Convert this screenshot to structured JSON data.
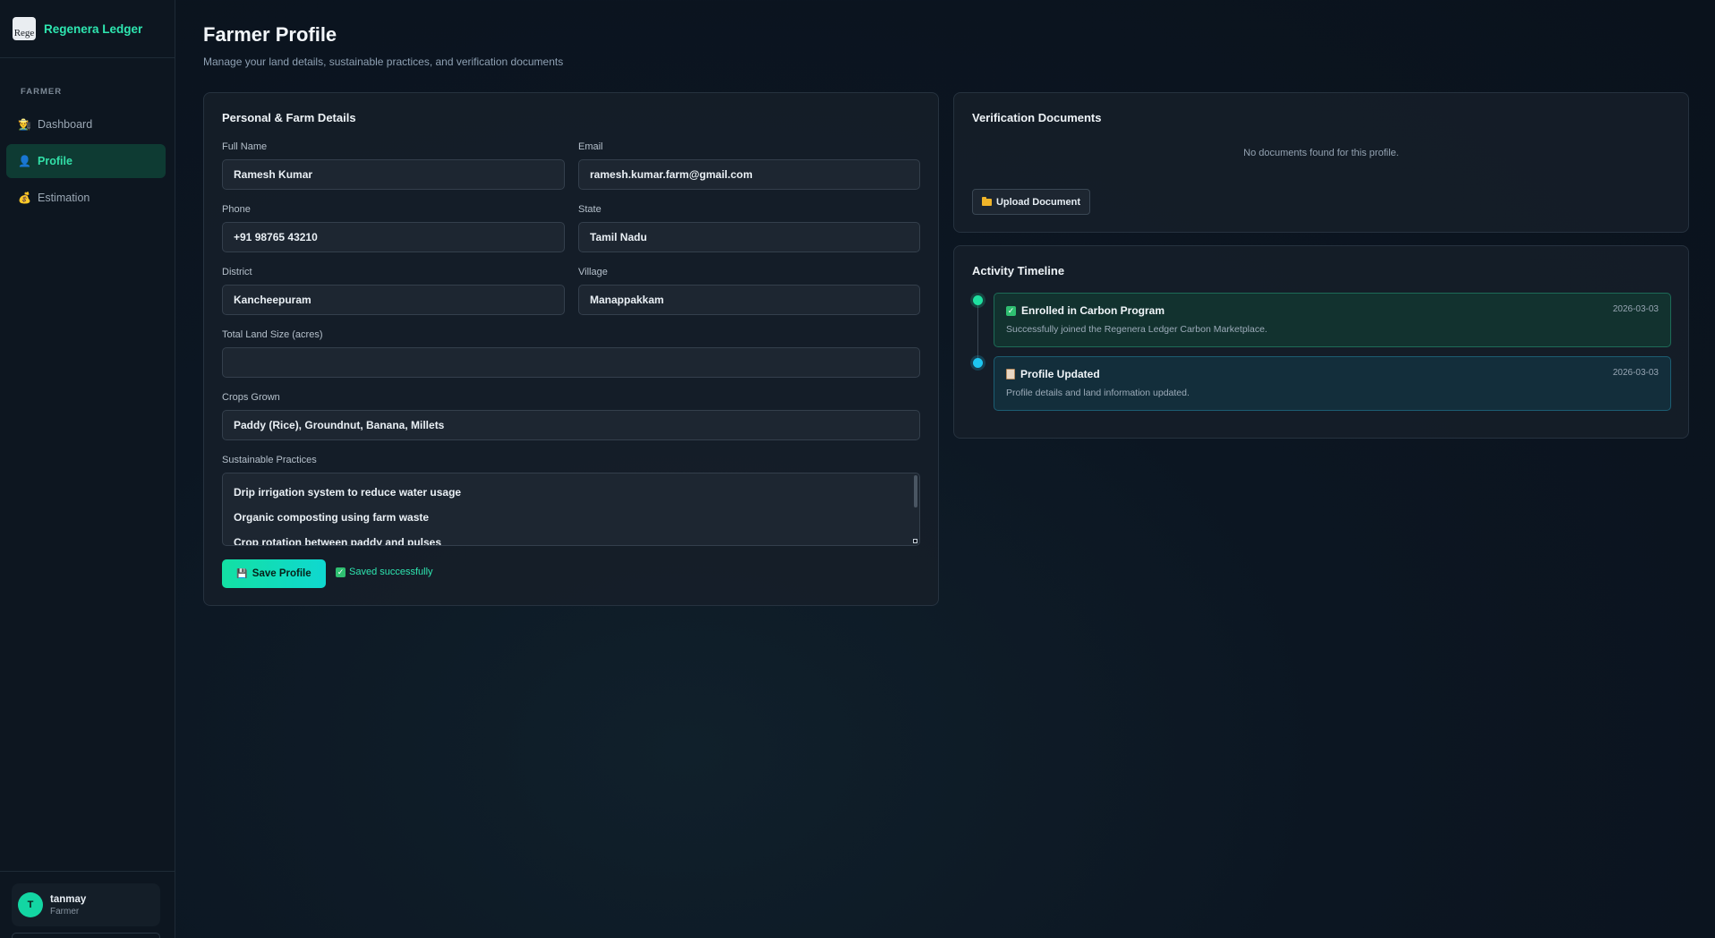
{
  "brand": {
    "name": "Regenera Ledger",
    "logo_alt": "Rege"
  },
  "sidebar": {
    "section": "FARMER",
    "items": [
      {
        "label": "Dashboard",
        "icon": "farmer-icon"
      },
      {
        "label": "Profile",
        "icon": "user-icon"
      },
      {
        "label": "Estimation",
        "icon": "money-bag-icon"
      }
    ],
    "active": "Profile"
  },
  "user": {
    "initial": "T",
    "name": "tanmay",
    "role": "Farmer"
  },
  "page": {
    "title": "Farmer Profile",
    "subtitle": "Manage your land details, sustainable practices, and verification documents"
  },
  "form": {
    "title": "Personal & Farm Details",
    "full_name_label": "Full Name",
    "full_name": "Ramesh Kumar",
    "email_label": "Email",
    "email": "ramesh.kumar.farm@gmail.com",
    "phone_label": "Phone",
    "phone": "+91 98765 43210",
    "state_label": "State",
    "state": "Tamil Nadu",
    "district_label": "District",
    "district": "Kancheepuram",
    "village_label": "Village",
    "village": "Manappakkam",
    "land_label": "Total Land Size (acres)",
    "land": "",
    "crops_label": "Crops Grown",
    "crops": "Paddy (Rice), Groundnut, Banana, Millets",
    "practices_label": "Sustainable Practices",
    "practices": [
      "Drip irrigation system to reduce water usage",
      "Organic composting using farm waste",
      "Crop rotation between paddy and pulses"
    ],
    "save_label": "Save Profile",
    "saved_message": "Saved successfully"
  },
  "docs": {
    "title": "Verification Documents",
    "empty": "No documents found for this profile.",
    "upload_label": "Upload Document"
  },
  "timeline": {
    "title": "Activity Timeline",
    "events": [
      {
        "title": "Enrolled in Carbon Program",
        "desc": "Successfully joined the Regenera Ledger Carbon Marketplace.",
        "date": "2026-03-03"
      },
      {
        "title": "Profile Updated",
        "desc": "Profile details and land information updated.",
        "date": "2026-03-03"
      }
    ]
  },
  "colors": {
    "accent": "#2ee6b0",
    "accent_blue": "#1ec6f0",
    "background": "#0c1622"
  }
}
